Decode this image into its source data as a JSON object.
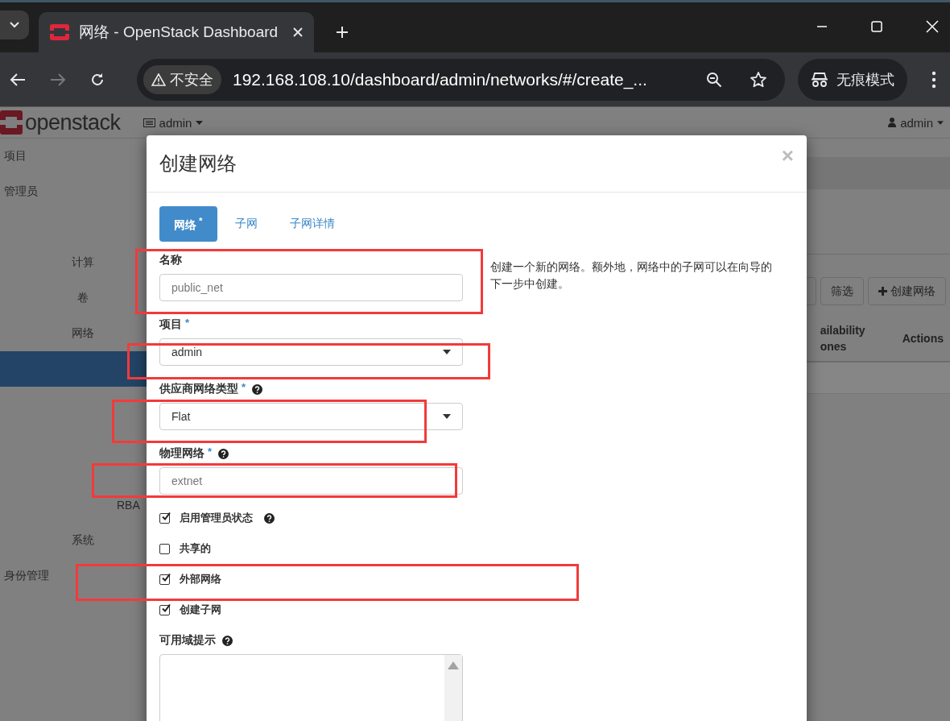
{
  "browser": {
    "tabs": [
      {
        "title": "网络 - OpenStack Dashboard",
        "selected": true
      }
    ],
    "address": {
      "security_label": "不安全",
      "url": "192.168.108.10/dashboard/admin/networks/#/create_..."
    },
    "profile_label": "无痕模式"
  },
  "header": {
    "logo": "openstack",
    "project": "admin",
    "user": "admin"
  },
  "sidebar": {
    "items": [
      {
        "label": "项目",
        "kind": "dashboard"
      },
      {
        "label": "管理员",
        "kind": "dashboard",
        "children": [
          {
            "label": "计算",
            "kind": "group"
          },
          {
            "label": "卷",
            "kind": "group"
          },
          {
            "label": "网络",
            "kind": "group",
            "children": [
              {
                "label": "RBA",
                "kind": "panel"
              }
            ]
          },
          {
            "label": "系统",
            "kind": "group"
          }
        ]
      },
      {
        "label": "身份管理",
        "kind": "dashboard"
      }
    ]
  },
  "toolbar": {
    "buttons": [
      {
        "label": "筛选",
        "kind": "plain"
      },
      {
        "label": "创建网络",
        "kind": "add"
      }
    ]
  },
  "table": {
    "columns": [
      {
        "lines": [
          "ailability",
          "ones"
        ]
      },
      {
        "lines": [
          "Actions"
        ]
      }
    ]
  },
  "modal": {
    "title": "创建网络",
    "close": "×",
    "tabs": [
      {
        "label": "网络",
        "required_mark": "*",
        "selected": true
      },
      {
        "label": "子网",
        "selected": false
      },
      {
        "label": "子网详情",
        "selected": false
      }
    ],
    "help": "创建一个新的网络。额外地，网络中的子网可以在向导的下一步中创建。",
    "fields": [
      {
        "label": "名称",
        "kind": "text",
        "help_icon": false,
        "placeholder": "public_net"
      },
      {
        "label": "项目",
        "kind": "select",
        "required_mark": "*",
        "help_icon": false,
        "value": "admin"
      },
      {
        "label": "供应商网络类型",
        "kind": "select",
        "required_mark": "*",
        "help_icon": true,
        "value": "Flat"
      },
      {
        "label": "物理网络",
        "kind": "text",
        "required_mark": "*",
        "help_icon": true,
        "placeholder": "extnet"
      }
    ],
    "checks": [
      {
        "label": "启用管理员状态",
        "checked": true,
        "help_icon": true
      },
      {
        "label": "共享的",
        "checked": false,
        "help_icon": false
      },
      {
        "label": "外部网络",
        "checked": true,
        "help_icon": false
      },
      {
        "label": "创建子网",
        "checked": true,
        "help_icon": false
      }
    ],
    "az_hint": {
      "label": "可用域提示",
      "help_icon": true
    }
  }
}
